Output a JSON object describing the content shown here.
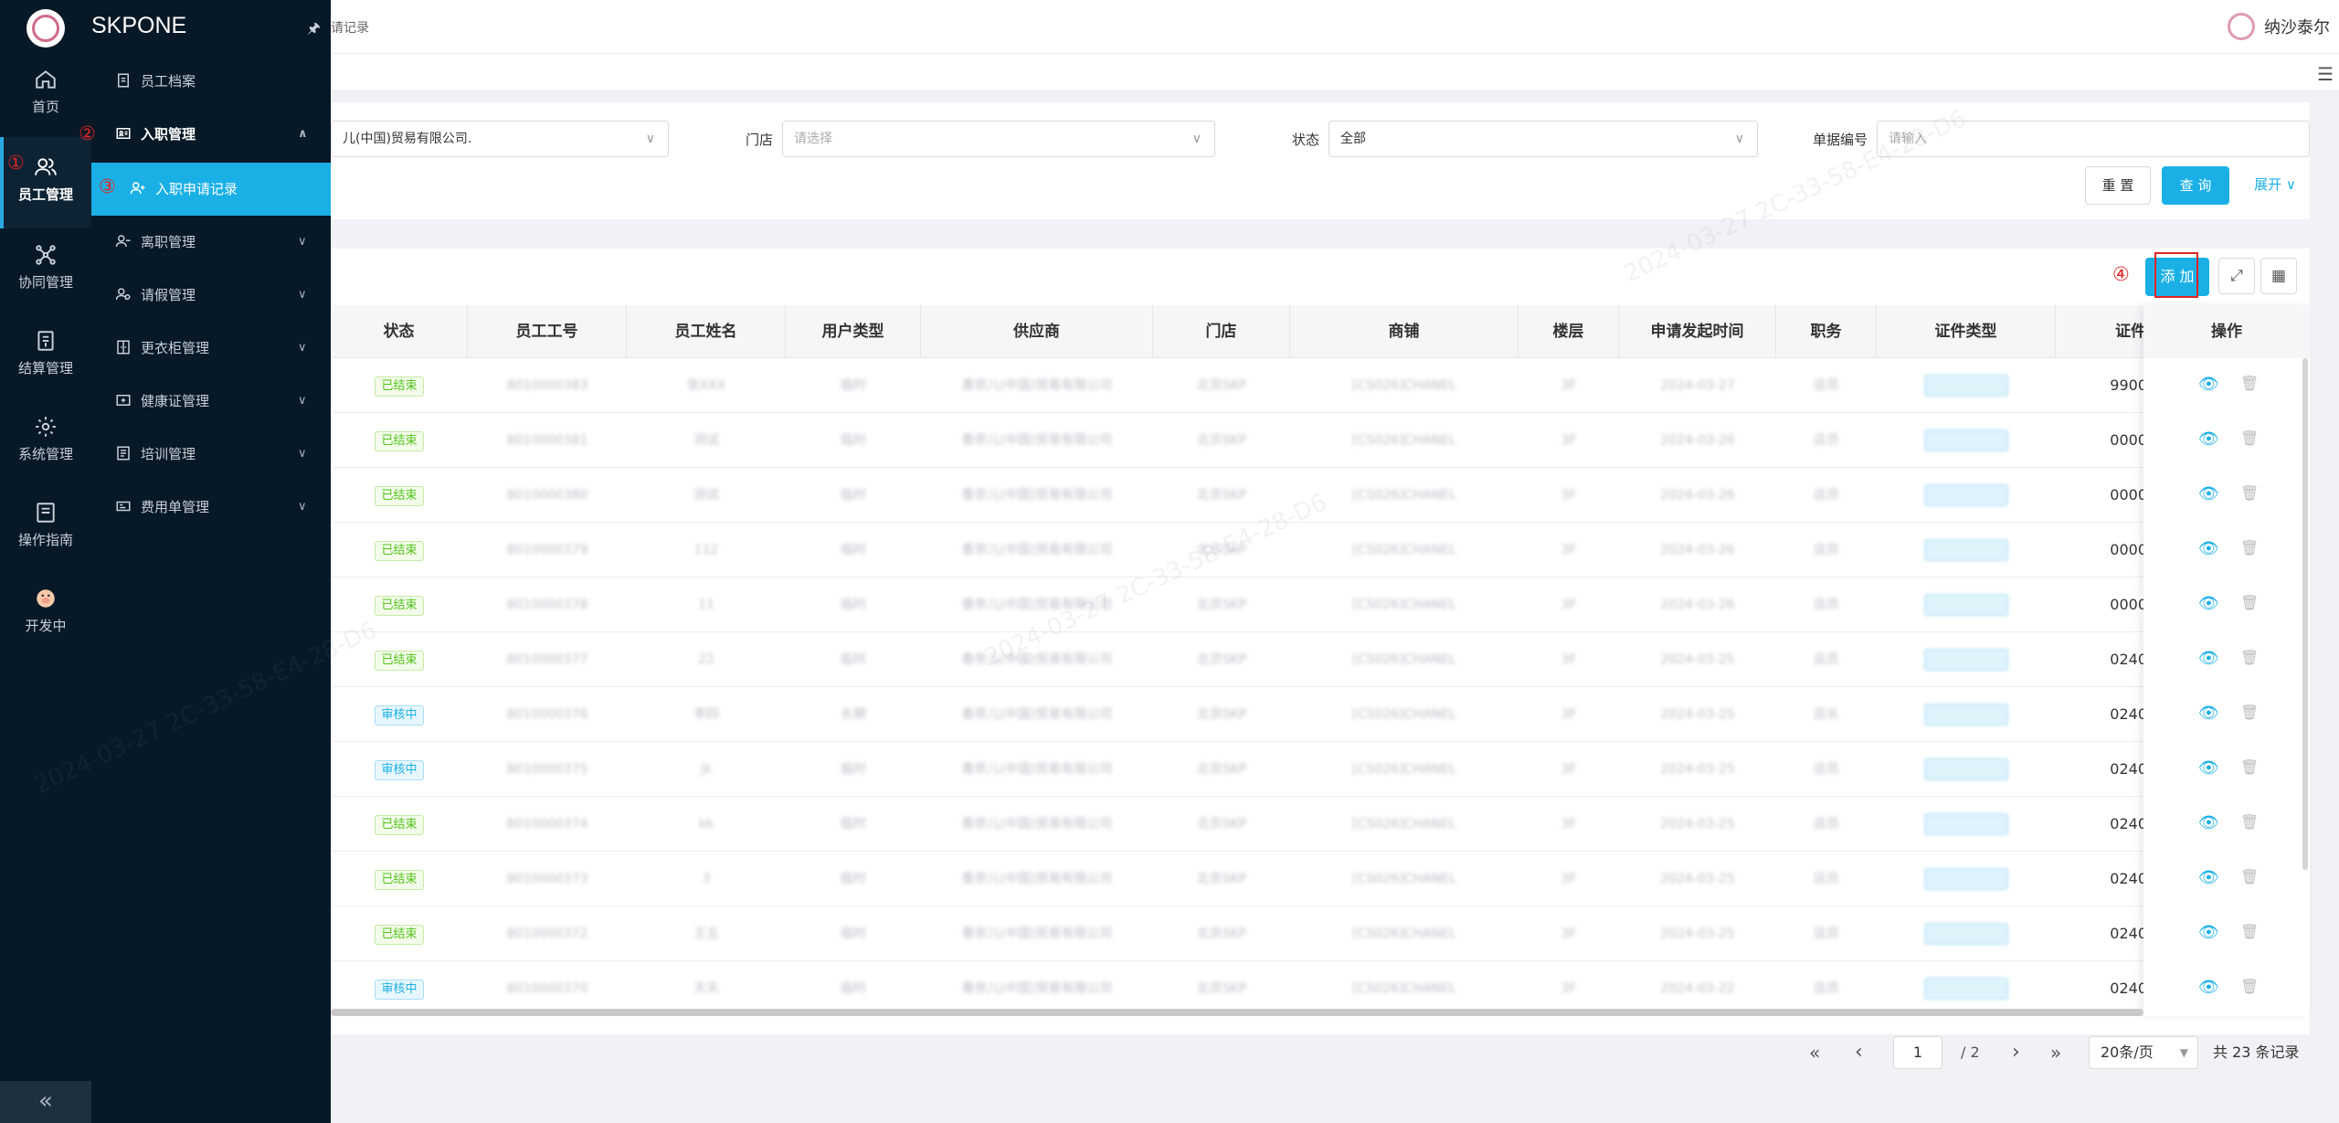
{
  "brand": {
    "name": "SKPONE",
    "pin": "🖈"
  },
  "rail": {
    "items": [
      {
        "label": "首页",
        "icon": "home-icon"
      },
      {
        "label": "员工管理",
        "icon": "users-icon",
        "active": true
      },
      {
        "label": "协同管理",
        "icon": "collab-icon"
      },
      {
        "label": "结算管理",
        "icon": "settlement-icon"
      },
      {
        "label": "系统管理",
        "icon": "settings-icon"
      },
      {
        "label": "操作指南",
        "icon": "guide-icon"
      },
      {
        "label": "开发中",
        "icon": "pig-icon"
      }
    ],
    "collapse": "«"
  },
  "submenu": {
    "items": [
      {
        "label": "员工档案"
      },
      {
        "label": "入职管理",
        "open": true
      },
      {
        "label": "入职申请记录",
        "active": true
      },
      {
        "label": "离职管理"
      },
      {
        "label": "请假管理"
      },
      {
        "label": "更衣柜管理"
      },
      {
        "label": "健康证管理"
      },
      {
        "label": "培训管理"
      },
      {
        "label": "费用单管理"
      }
    ]
  },
  "header": {
    "breadcrumb": "请记录",
    "user": "纳沙泰尔"
  },
  "steps": {
    "s1": "①",
    "s2": "②",
    "s3": "③",
    "s4": "④"
  },
  "filter": {
    "company_value": "儿(中国)贸易有限公司.",
    "store_label": "门店",
    "store_placeholder": "请选择",
    "status_label": "状态",
    "status_value": "全部",
    "doc_label": "单据编号",
    "doc_placeholder": "请输入",
    "reset": "重 置",
    "query": "查 询",
    "expand": "展开 ∨"
  },
  "toolbar": {
    "add": "添 加",
    "fullscreen": "⤢",
    "layout": "▦"
  },
  "table": {
    "columns": [
      "状态",
      "员工工号",
      "员工姓名",
      "用户类型",
      "供应商",
      "门店",
      "商铺",
      "楼层",
      "申请发起时间",
      "职务",
      "证件类型",
      "证件",
      "操作"
    ],
    "rows": [
      {
        "status": "已结束",
        "type": "done",
        "id": "8010000383",
        "name": "张XXX",
        "utype": "临时",
        "supplier": "香奈儿(中国)贸易有限公司",
        "store": "北京SKP",
        "shop": "[CS026]CHANEL",
        "floor": "3F",
        "date": "2024-03-27",
        "role": "店员",
        "cert_tail": "9900"
      },
      {
        "status": "已结束",
        "type": "done",
        "id": "8010000381",
        "name": "测试",
        "utype": "临时",
        "supplier": "香奈儿(中国)贸易有限公司",
        "store": "北京SKP",
        "shop": "[CS026]CHANEL",
        "floor": "3F",
        "date": "2024-03-26",
        "role": "店员",
        "cert_tail": "0000"
      },
      {
        "status": "已结束",
        "type": "done",
        "id": "8010000380",
        "name": "测试",
        "utype": "临时",
        "supplier": "香奈儿(中国)贸易有限公司",
        "store": "北京SKP",
        "shop": "[CS026]CHANEL",
        "floor": "3F",
        "date": "2024-03-26",
        "role": "店员",
        "cert_tail": "0000"
      },
      {
        "status": "已结束",
        "type": "done",
        "id": "8010000379",
        "name": "112",
        "utype": "临时",
        "supplier": "香奈儿(中国)贸易有限公司",
        "store": "北京SKP",
        "shop": "[CS026]CHANEL",
        "floor": "3F",
        "date": "2024-03-26",
        "role": "店员",
        "cert_tail": "0000"
      },
      {
        "status": "已结束",
        "type": "done",
        "id": "8010000378",
        "name": "11",
        "utype": "临时",
        "supplier": "香奈儿(中国)贸易有限公司",
        "store": "北京SKP",
        "shop": "[CS026]CHANEL",
        "floor": "3F",
        "date": "2024-03-26",
        "role": "店员",
        "cert_tail": "0000"
      },
      {
        "status": "已结束",
        "type": "done",
        "id": "8010000377",
        "name": "22",
        "utype": "临时",
        "supplier": "香奈儿(中国)贸易有限公司",
        "store": "北京SKP",
        "shop": "[CS026]CHANEL",
        "floor": "3F",
        "date": "2024-03-25",
        "role": "店员",
        "cert_tail": "0240"
      },
      {
        "status": "审核中",
        "type": "review",
        "id": "8010000376",
        "name": "李四",
        "utype": "长期",
        "supplier": "香奈儿(中国)贸易有限公司",
        "store": "北京SKP",
        "shop": "[CS026]CHANEL",
        "floor": "3F",
        "date": "2024-03-25",
        "role": "店长",
        "cert_tail": "0240"
      },
      {
        "status": "审核中",
        "type": "review",
        "id": "8010000375",
        "name": "jk",
        "utype": "临时",
        "supplier": "香奈儿(中国)贸易有限公司",
        "store": "北京SKP",
        "shop": "[CS026]CHANEL",
        "floor": "3F",
        "date": "2024-03-25",
        "role": "店员",
        "cert_tail": "0240"
      },
      {
        "status": "已结束",
        "type": "done",
        "id": "8010000374",
        "name": "kk",
        "utype": "临时",
        "supplier": "香奈儿(中国)贸易有限公司",
        "store": "北京SKP",
        "shop": "[CS026]CHANEL",
        "floor": "3F",
        "date": "2024-03-25",
        "role": "店员",
        "cert_tail": "0240"
      },
      {
        "status": "已结束",
        "type": "done",
        "id": "8010000373",
        "name": "3",
        "utype": "临时",
        "supplier": "香奈儿(中国)贸易有限公司",
        "store": "北京SKP",
        "shop": "[CS026]CHANEL",
        "floor": "3F",
        "date": "2024-03-25",
        "role": "店员",
        "cert_tail": "0240"
      },
      {
        "status": "已结束",
        "type": "done",
        "id": "8010000372",
        "name": "王五",
        "utype": "临时",
        "supplier": "香奈儿(中国)贸易有限公司",
        "store": "北京SKP",
        "shop": "[CS026]CHANEL",
        "floor": "3F",
        "date": "2024-03-25",
        "role": "店员",
        "cert_tail": "0240"
      },
      {
        "status": "审核中",
        "type": "review",
        "id": "8010000370",
        "name": "天天",
        "utype": "临时",
        "supplier": "香奈儿(中国)贸易有限公司",
        "store": "北京SKP",
        "shop": "[CS026]CHANEL",
        "floor": "3F",
        "date": "2024-03-22",
        "role": "店员",
        "cert_tail": "0240"
      }
    ]
  },
  "pagination": {
    "first": "«",
    "prev": "‹",
    "page": "1",
    "total_pages": "/ 2",
    "next": "›",
    "last": "»",
    "size": "20条/页",
    "total": "共 23 条记录"
  },
  "colors": {
    "accent": "#1ab0e6",
    "sidebar": "#071826",
    "done": "#52c41a",
    "annotation": "#e02424"
  }
}
